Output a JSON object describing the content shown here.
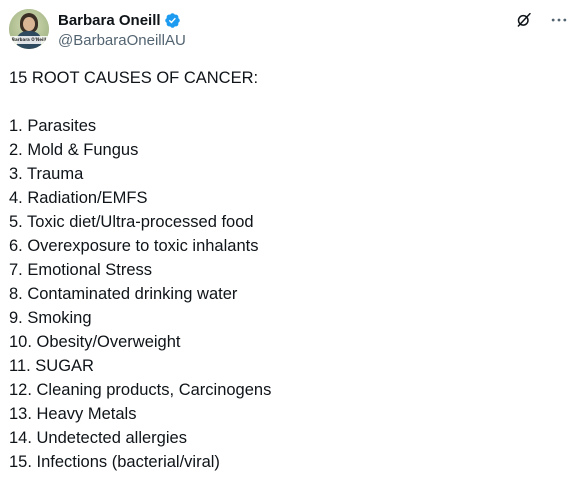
{
  "author": {
    "display_name": "Barbara Oneill",
    "handle": "@BarbaraOneillAU",
    "avatar_caption": "Barbara O'Neill",
    "verified": true,
    "verified_color": "#1d9bf0"
  },
  "icons": {
    "verified": "verified-badge-icon",
    "grok": "grok-icon",
    "more": "more-icon"
  },
  "post": {
    "title": "15 ROOT CAUSES OF CANCER:",
    "items": [
      "1. Parasites",
      "2. Mold & Fungus",
      "3. Trauma",
      "4. Radiation/EMFS",
      "5. Toxic diet/Ultra-processed food",
      "6. Overexposure to toxic inhalants",
      "7. Emotional Stress",
      "8. Contaminated drinking water",
      "9. Smoking",
      "10. Obesity/Overweight",
      "11. SUGAR",
      "12. Cleaning products, Carcinogens",
      "13. Heavy Metals",
      "14. Undetected allergies",
      "15. Infections (bacterial/viral)"
    ]
  },
  "colors": {
    "text": "#0f1419",
    "secondary_text": "#536471",
    "background": "#ffffff"
  }
}
